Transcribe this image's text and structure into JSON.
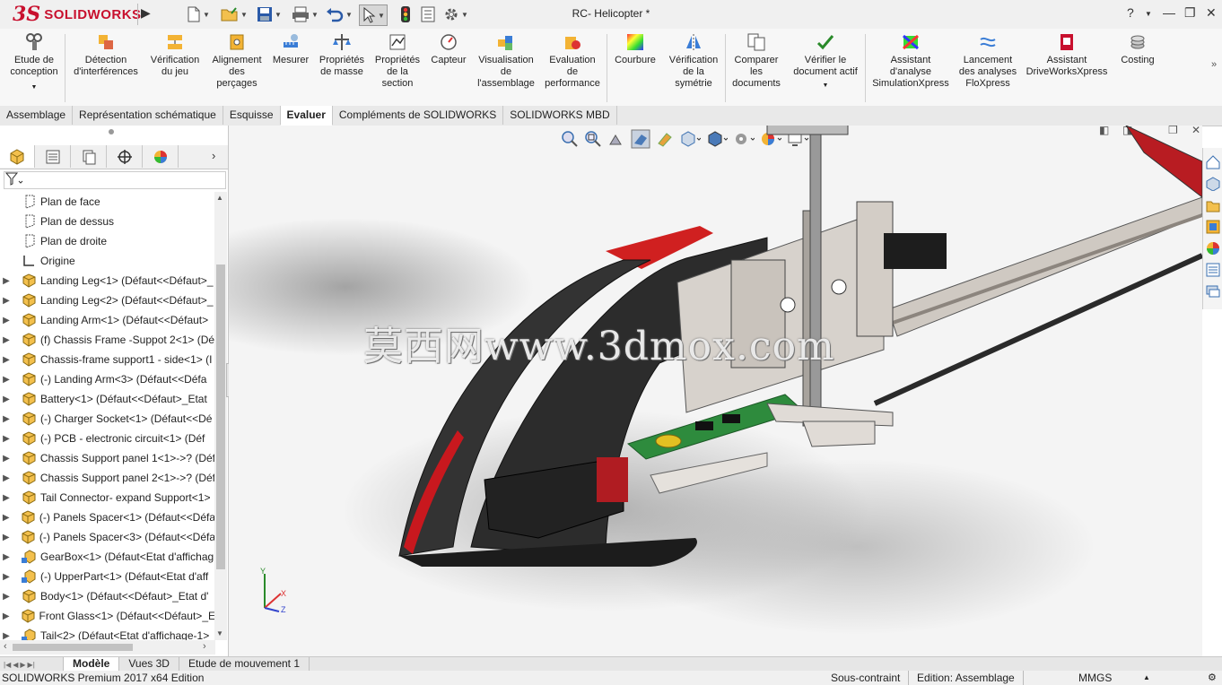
{
  "app": {
    "logo_ds": "3S",
    "logo_text": "SOLIDWORKS",
    "document_title": "RC- Helicopter *",
    "help": "?",
    "colors": {
      "brand": "#c8102e",
      "ribbon_bg": "#f7f7f7",
      "tab_active": "#ffffff"
    }
  },
  "quick_access": [
    "new-document",
    "open",
    "save",
    "print",
    "undo",
    "select",
    "rebuild",
    "file-properties",
    "options"
  ],
  "ribbon": {
    "commands": [
      {
        "label": "Etude de\nconception",
        "icon": "design-study-icon"
      },
      {
        "label": "Détection\nd'interférences",
        "icon": "interference-icon"
      },
      {
        "label": "Vérification\ndu jeu",
        "icon": "clearance-icon"
      },
      {
        "label": "Alignement\ndes\nperçages",
        "icon": "hole-alignment-icon"
      },
      {
        "label": "Mesurer",
        "icon": "measure-icon"
      },
      {
        "label": "Propriétés\nde masse",
        "icon": "mass-properties-icon"
      },
      {
        "label": "Propriétés\nde la\nsection",
        "icon": "section-properties-icon"
      },
      {
        "label": "Capteur",
        "icon": "sensor-icon"
      },
      {
        "label": "Visualisation\nde\nl'assemblage",
        "icon": "assembly-visualization-icon"
      },
      {
        "label": "Evaluation\nde\nperformance",
        "icon": "performance-evaluation-icon"
      },
      {
        "label": "Courbure",
        "icon": "curvature-icon"
      },
      {
        "label": "Vérification\nde la\nsymétrie",
        "icon": "symmetry-check-icon"
      },
      {
        "label": "Comparer\nles\ndocuments",
        "icon": "compare-documents-icon"
      },
      {
        "label": "Vérifier le\ndocument actif",
        "icon": "check-active-document-icon"
      },
      {
        "label": "Assistant\nd'analyse\nSimulationXpress",
        "icon": "simulationxpress-icon"
      },
      {
        "label": "Lancement\ndes analyses\nFloXpress",
        "icon": "floxpress-icon"
      },
      {
        "label": "Assistant\nDriveWorksXpress",
        "icon": "driveworksxpress-icon"
      },
      {
        "label": "Costing",
        "icon": "costing-icon"
      }
    ]
  },
  "tabs": [
    {
      "label": "Assemblage",
      "active": false
    },
    {
      "label": "Représentation schématique",
      "active": false
    },
    {
      "label": "Esquisse",
      "active": false
    },
    {
      "label": "Evaluer",
      "active": true
    },
    {
      "label": "Compléments de SOLIDWORKS",
      "active": false
    },
    {
      "label": "SOLIDWORKS MBD",
      "active": false
    }
  ],
  "tree": {
    "items": [
      {
        "label": "Plan de face",
        "type": "plane"
      },
      {
        "label": "Plan de dessus",
        "type": "plane"
      },
      {
        "label": "Plan de droite",
        "type": "plane"
      },
      {
        "label": "Origine",
        "type": "origin"
      },
      {
        "label": "Landing Leg<1> (Défaut<<Défaut>_",
        "type": "part"
      },
      {
        "label": "Landing Leg<2> (Défaut<<Défaut>_",
        "type": "part"
      },
      {
        "label": "Landing Arm<1> (Défaut<<Défaut>",
        "type": "part"
      },
      {
        "label": "(f) Chassis Frame -Suppot 2<1> (Dé",
        "type": "part"
      },
      {
        "label": "Chassis-frame support1 - side<1> (I",
        "type": "part"
      },
      {
        "label": "(-) Landing Arm<3> (Défaut<<Défa",
        "type": "part"
      },
      {
        "label": "Battery<1> (Défaut<<Défaut>_Etat",
        "type": "part"
      },
      {
        "label": "(-) Charger Socket<1> (Défaut<<Dé",
        "type": "part"
      },
      {
        "label": "(-) PCB -  electronic circuit<1> (Déf",
        "type": "part"
      },
      {
        "label": "Chassis Support panel 1<1>->? (Déf",
        "type": "part"
      },
      {
        "label": "Chassis Support panel 2<1>->? (Déf",
        "type": "part"
      },
      {
        "label": "Tail Connector- expand Support<1>",
        "type": "part"
      },
      {
        "label": "(-) Panels Spacer<1> (Défaut<<Défa",
        "type": "part"
      },
      {
        "label": "(-) Panels Spacer<3> (Défaut<<Défa",
        "type": "part"
      },
      {
        "label": "GearBox<1> (Défaut<Etat d'affichag",
        "type": "assembly"
      },
      {
        "label": "(-) UpperPart<1> (Défaut<Etat d'aff",
        "type": "assembly"
      },
      {
        "label": "Body<1> (Défaut<<Défaut>_Etat d'",
        "type": "part"
      },
      {
        "label": "Front Glass<1> (Défaut<<Défaut>_E",
        "type": "part"
      },
      {
        "label": "Tail<2> (Défaut<Etat d'affichage-1>",
        "type": "assembly"
      }
    ]
  },
  "viewport": {
    "watermark": "莫西网www.3dmox.com",
    "triad": {
      "x": "X",
      "y": "Y",
      "z": "Z"
    }
  },
  "bottom_tabs": [
    {
      "label": "Modèle",
      "active": true
    },
    {
      "label": "Vues 3D",
      "active": false
    },
    {
      "label": "Etude de mouvement 1",
      "active": false
    }
  ],
  "status": {
    "product": "SOLIDWORKS Premium 2017 x64 Edition",
    "constraint": "Sous-contraint",
    "mode": "Edition: Assemblage",
    "units": "MMGS"
  }
}
